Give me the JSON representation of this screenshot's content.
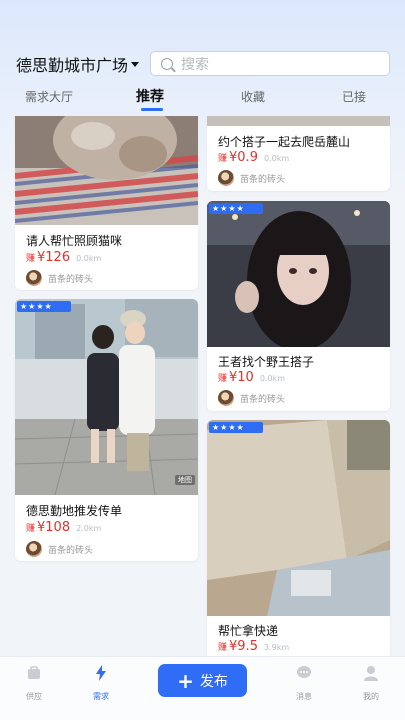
{
  "header": {
    "location": "德思勤城市广场",
    "search_placeholder": "搜索"
  },
  "tabs": [
    {
      "label": "需求大厅"
    },
    {
      "label": "推荐"
    },
    {
      "label": "收藏"
    },
    {
      "label": "已接"
    }
  ],
  "cards": [
    {
      "title": "请人帮忙照顾猫咪",
      "earn_word": "赚",
      "price": "¥126",
      "distance": "0.0km",
      "author": "苗条的砖头",
      "rating": 4
    },
    {
      "title": "德思勤地推发传单",
      "earn_word": "赚",
      "price": "¥108",
      "distance": "2.0km",
      "author": "苗条的砖头",
      "rating": 4
    },
    {
      "title": "约个搭子一起去爬岳麓山",
      "earn_word": "赚",
      "price": "¥0.9",
      "distance": "0.0km",
      "author": "苗条的砖头",
      "rating": 4
    },
    {
      "title": "王者找个野王搭子",
      "earn_word": "赚",
      "price": "¥10",
      "distance": "0.0km",
      "author": "苗条的砖头",
      "rating": 4
    },
    {
      "title": "帮忙拿快递",
      "earn_word": "赚",
      "price": "¥9.5",
      "distance": "3.9km",
      "author": "苗条的砖头",
      "rating": 4
    }
  ],
  "photo_overlay_text": "地图",
  "bottom_nav": {
    "supply": "供应",
    "demand": "需求",
    "publish": "发布",
    "messages": "消息",
    "mine": "我的"
  },
  "colors": {
    "accent": "#2f6df6",
    "price": "#e0312c",
    "background": "#f1f4f9"
  }
}
